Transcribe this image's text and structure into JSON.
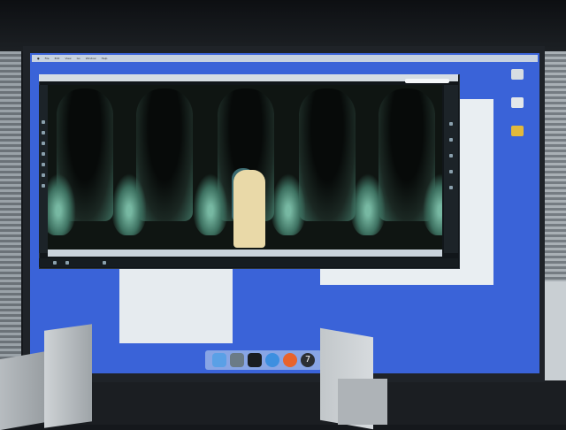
{
  "scene": {
    "colors": {
      "projection_background": "#3a63d8",
      "room": "#15181c",
      "canvas_art": "#3c6d5e"
    }
  },
  "menubar": {
    "items": [
      "",
      "File",
      "Edit",
      "View",
      "Go",
      "Window",
      "Help"
    ],
    "right_status": ""
  },
  "desktop_icons": [
    "drive-icon",
    "drive-icon",
    "folder-icon"
  ],
  "app_window": {
    "title": "",
    "search_placeholder": ""
  },
  "finder_bottom": {
    "rows": [
      "",
      ""
    ]
  },
  "finder_right": {
    "rows": [
      "",
      ""
    ]
  },
  "dock": {
    "icons": [
      "finder-icon",
      "app-icon",
      "terminal-icon",
      "safari-icon",
      "firefox-icon",
      "app-7-icon"
    ],
    "badge_label": "7"
  }
}
